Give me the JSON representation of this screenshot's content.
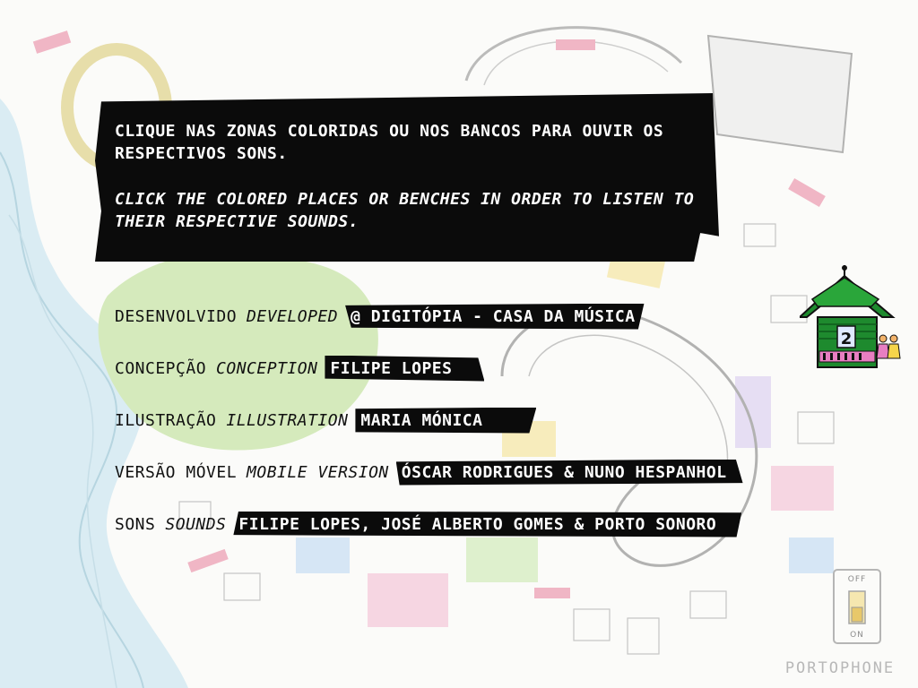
{
  "instructions": {
    "pt": "CLIQUE NAS ZONAS COLORIDAS OU NOS BANCOS PARA OUVIR OS RESPECTIVOS SONS.",
    "en": "CLICK THE COLORED PLACES OR BENCHES IN ORDER TO LISTEN TO THEIR RESPECTIVE SOUNDS."
  },
  "credits": [
    {
      "label_pt": "DESENVOLVIDO",
      "label_en": "DEVELOPED",
      "value": "@ DIGITÓPIA - CASA DA MÚSICA"
    },
    {
      "label_pt": "CONCEPÇÃO",
      "label_en": "CONCEPTION",
      "value": "FILIPE LOPES"
    },
    {
      "label_pt": "ILUSTRAÇÃO",
      "label_en": "ILLUSTRATION",
      "value": "MARIA MÓNICA"
    },
    {
      "label_pt": "VERSÃO MÓVEL",
      "label_en": "MOBILE VERSION",
      "value": "ÓSCAR RODRIGUES & NUNO HESPANHOL"
    },
    {
      "label_pt": "SONS",
      "label_en": "SOUNDS",
      "value": "FILIPE LOPES, JOSÉ ALBERTO GOMES & PORTO SONORO"
    }
  ],
  "kiosk": {
    "icon": "kiosk-icon",
    "number": "2"
  },
  "power_switch": {
    "icon": "power-switch-icon",
    "off_label": "OFF",
    "on_label": "ON"
  },
  "brand": "PORTOPHONE",
  "colors": {
    "box": "#0b0b0b",
    "box_text": "#ffffff",
    "river": "#bfe0ef",
    "park": "#b6dd8a",
    "kiosk_green": "#1e8a2e"
  }
}
